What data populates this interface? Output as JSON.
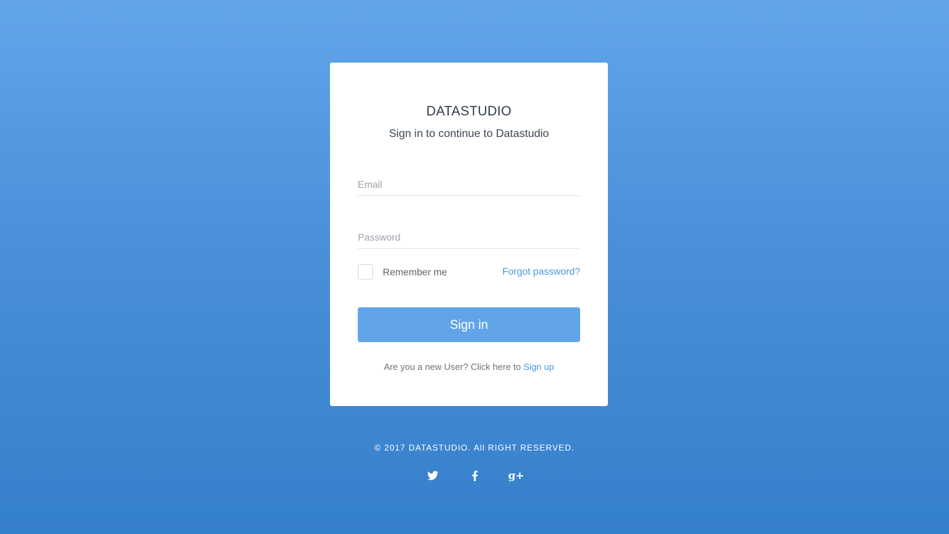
{
  "brand": "DATASTUDIO",
  "subtitle": "Sign in to continue to Datastudio",
  "form": {
    "email_placeholder": "Email",
    "email_value": "",
    "password_placeholder": "Password",
    "password_value": "",
    "remember_label": "Remember me",
    "remember_checked": false,
    "forgot_label": "Forgot password?",
    "submit_label": "Sign in"
  },
  "signup": {
    "prompt": "Are you a new User? Click here to ",
    "link_label": "Sign up"
  },
  "footer": {
    "copyright": "© 2017 DATASTUDIO. All RIGHT RESERVED."
  },
  "social": {
    "icons": [
      "twitter-icon",
      "facebook-icon",
      "google-plus-icon"
    ],
    "google_plus_glyph": "g+"
  },
  "colors": {
    "background_top": "#62a5e9",
    "background_bottom": "#3580cb",
    "accent": "#62a4e8",
    "link": "#4a97e0"
  }
}
